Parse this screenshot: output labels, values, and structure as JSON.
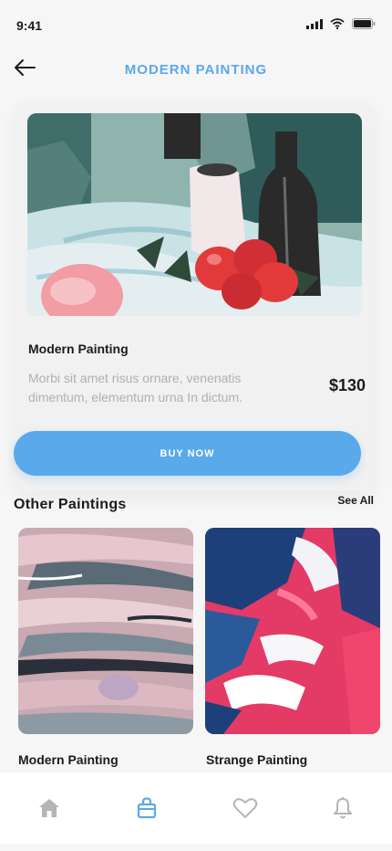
{
  "status": {
    "time": "9:41"
  },
  "header": {
    "title": "MODERN PAINTING"
  },
  "product": {
    "name": "Modern Painting",
    "description": "Morbi sit amet risus ornare, venenatis dimentum, elementum urna In dictum.",
    "price": "$130",
    "buy_label": "BUY NOW"
  },
  "section": {
    "title": "Other Paintings",
    "see_all": "See All"
  },
  "others": [
    {
      "name": "Modern Painting"
    },
    {
      "name": "Strange Painting"
    }
  ],
  "nav": [
    {
      "icon": "home-icon",
      "active": false
    },
    {
      "icon": "shopping-bag-icon",
      "active": true
    },
    {
      "icon": "heart-icon",
      "active": false
    },
    {
      "icon": "bell-icon",
      "active": false
    }
  ],
  "colors": {
    "accent": "#5aa9ea",
    "text": "#1b1b1b",
    "muted": "#b0b0b0",
    "inactive_icon": "#b5b5b5"
  }
}
